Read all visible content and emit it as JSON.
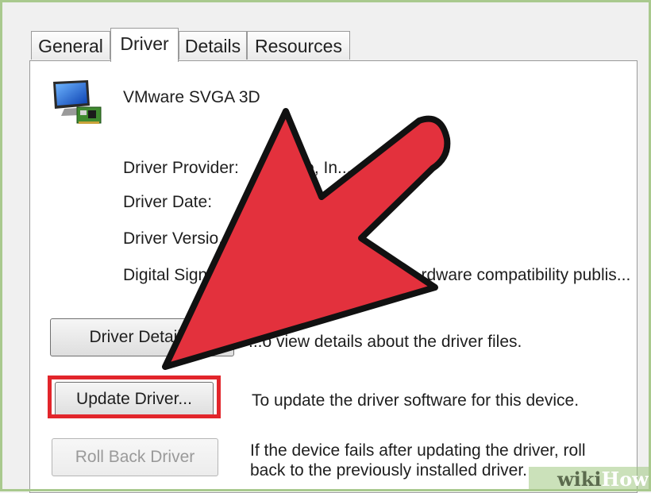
{
  "tabs": [
    {
      "label": "General"
    },
    {
      "label": "Driver"
    },
    {
      "label": "Details"
    },
    {
      "label": "Resources"
    }
  ],
  "device": {
    "name": "VMware SVGA 3D",
    "icon": "monitor-with-card-icon"
  },
  "info": {
    "provider_label": "Driver Provider:",
    "provider_value": "...are, In...",
    "date_label": "Driver Date:",
    "version_label": "Driver Versio...",
    "signer_label": "Digital Sign...",
    "signer_value": "...rdware compatibility publis..."
  },
  "buttons": {
    "details_label": "Driver Detail...",
    "details_desc": "...o view details about the driver files.",
    "update_label": "Update Driver...",
    "update_desc": "To update the driver software for this device.",
    "rollback_label": "Roll Back Driver",
    "rollback_desc_1": "If the device fails after updating the driver, roll",
    "rollback_desc_2": "back to the previously installed driver."
  },
  "watermark": {
    "wiki": "wiki",
    "how": "How"
  },
  "colors": {
    "arrow": "#e3313d",
    "highlight": "#e2252b",
    "frame": "#a9c98e"
  }
}
